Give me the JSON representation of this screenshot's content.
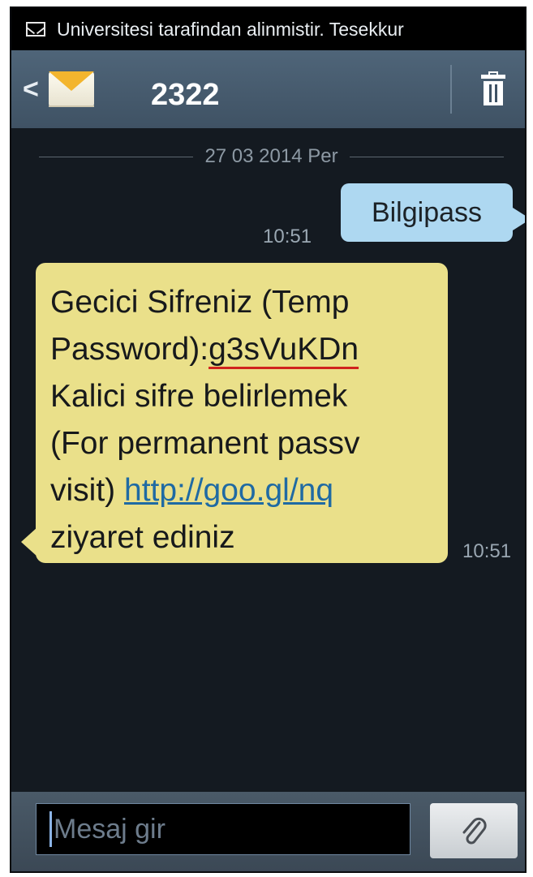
{
  "statusbar": {
    "ticker": "Universitesi tarafindan alinmistir. Tesekkur",
    "icon": "envelope-icon"
  },
  "header": {
    "back_icon": "back-arrow-icon",
    "back_glyph": "<",
    "avatar_icon": "envelope-icon",
    "contact": "2322",
    "delete_icon": "trash-icon"
  },
  "thread": {
    "date": "27 03 2014 Per",
    "messages": [
      {
        "direction": "outgoing",
        "text": "Bilgipass",
        "time": "10:51"
      },
      {
        "direction": "incoming",
        "lines": [
          "Gecici Sifreniz (Temp",
          "Password):",
          "g3sVuKDn",
          "Kalici sifre belirlemek",
          "(For permanent passv",
          "visit) ",
          "http://goo.gl/nq",
          "ziyaret ediniz"
        ],
        "time": "10:51"
      }
    ]
  },
  "compose": {
    "placeholder": "Mesaj gir",
    "attach_icon": "paperclip-icon"
  },
  "colors": {
    "outgoing_bubble": "#aed8f1",
    "incoming_bubble": "#eae08a",
    "header": "#4a5d70",
    "password_underline": "#d0231d",
    "link": "#1f6aa3"
  }
}
